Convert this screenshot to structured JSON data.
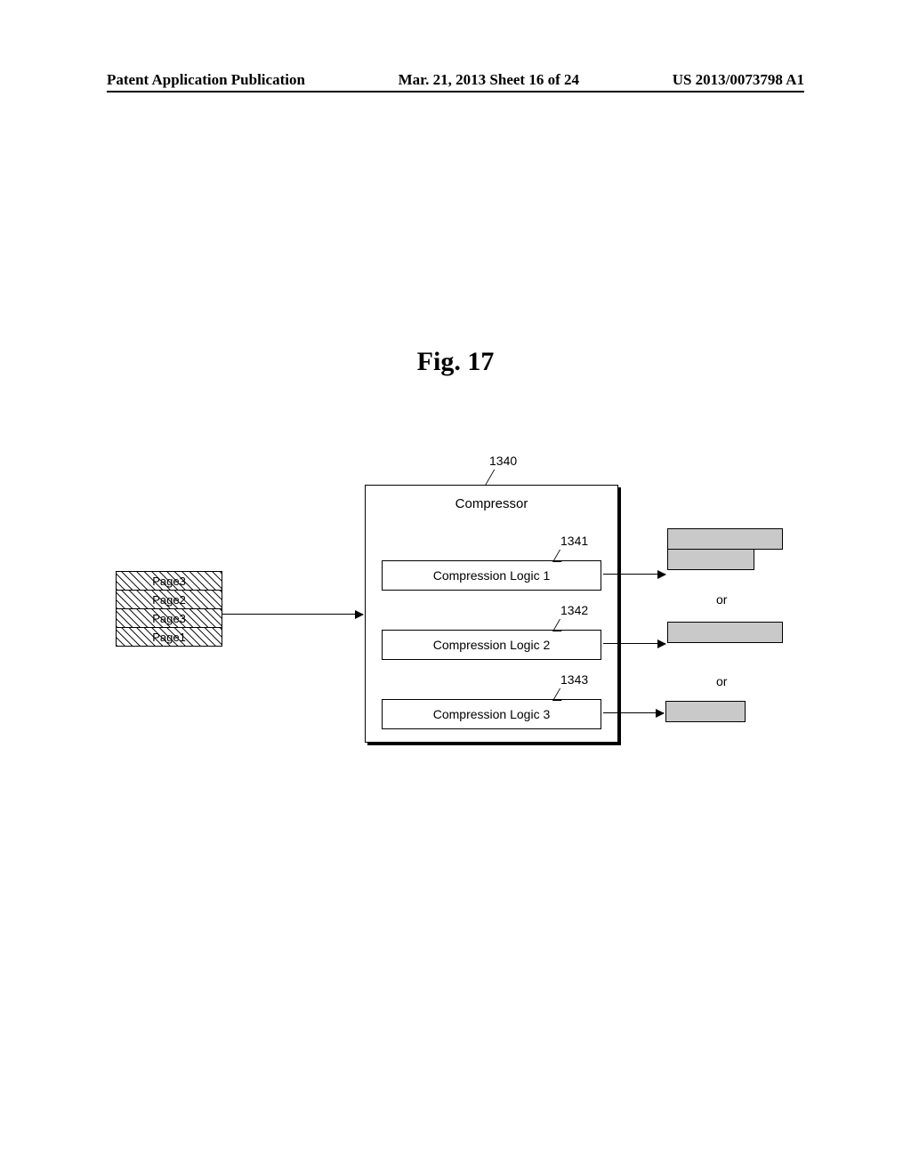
{
  "header": {
    "left": "Patent Application Publication",
    "center": "Mar. 21, 2013  Sheet 16 of 24",
    "right": "US 2013/0073798 A1"
  },
  "figure_label": "Fig. 17",
  "callouts": {
    "compressor": "1340",
    "logic1": "1341",
    "logic2": "1342",
    "logic3": "1343"
  },
  "compressor": {
    "title": "Compressor",
    "logic1": "Compression Logic 1",
    "logic2": "Compression Logic 2",
    "logic3": "Compression Logic 3"
  },
  "pages": {
    "p0": "Page3",
    "p1": "Page2",
    "p2": "Page3",
    "p3": "Page1"
  },
  "or_label": "or"
}
